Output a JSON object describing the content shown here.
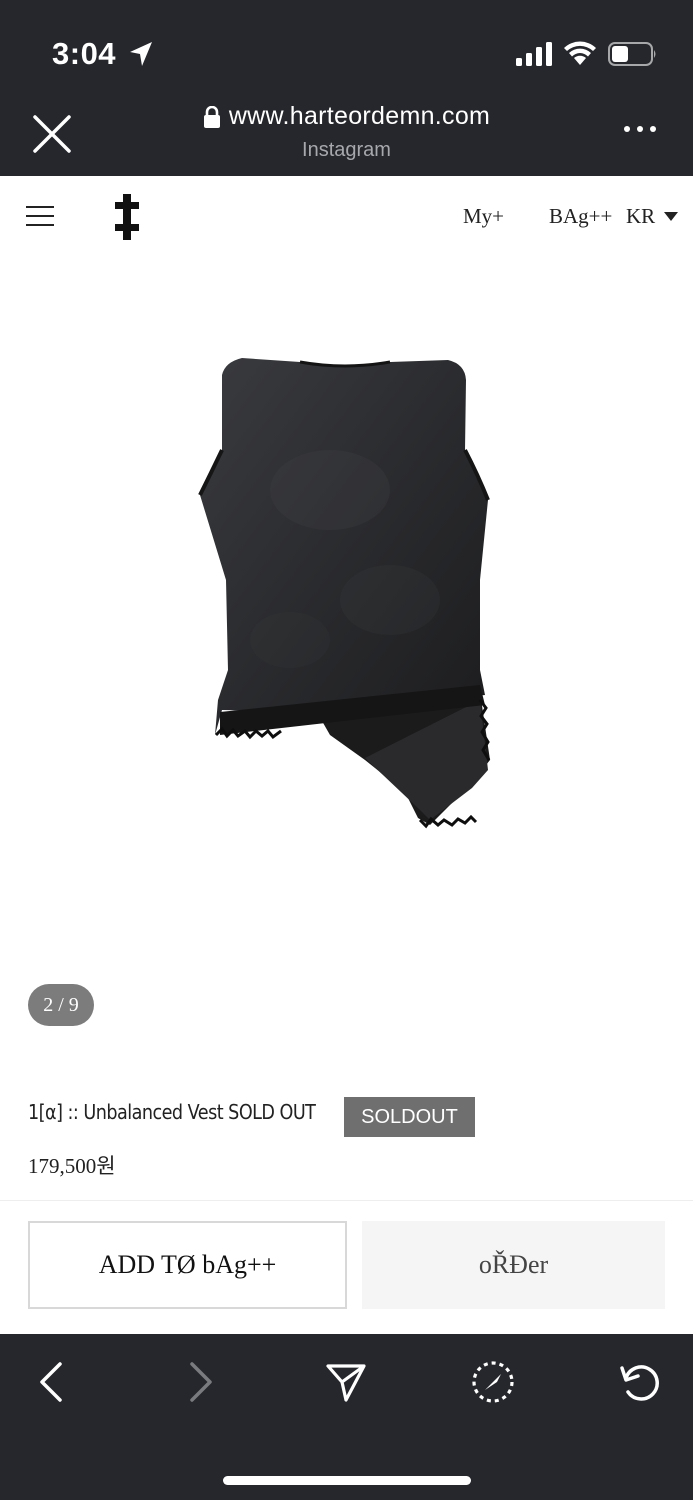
{
  "status_bar": {
    "time": "3:04",
    "icons": [
      "location-arrow-icon",
      "cellular-signal-icon",
      "wifi-icon",
      "battery-icon"
    ]
  },
  "browser": {
    "url": "www.harteordemn.com",
    "subtitle": "Instagram",
    "close_icon": "close-icon",
    "more_icon": "more-dots-icon"
  },
  "site_header": {
    "menu_icon": "hamburger-menu-icon",
    "logo_icon": "double-cross-logo-icon",
    "my_label": "My+",
    "bag_label": "BAg++",
    "lang_label": "KR"
  },
  "gallery": {
    "pager": "2 / 9",
    "image": "black asymmetric vest product photo"
  },
  "product": {
    "name": "1[α] :: Unbalanced Vest SOLD OUT",
    "badge": "SOLDOUT",
    "price": "179,500원"
  },
  "actions": {
    "add_to_bag": "ADD TØ bAg++",
    "order": "oŘĐer"
  },
  "toolbar": {
    "icons": [
      "back-icon",
      "forward-icon",
      "share-icon",
      "compass-icon",
      "reload-icon"
    ]
  },
  "colors": {
    "chrome": "#25272c",
    "badge": "#6f6f6f",
    "pager": "#7c7c7c",
    "order_bg": "#f5f5f5"
  }
}
